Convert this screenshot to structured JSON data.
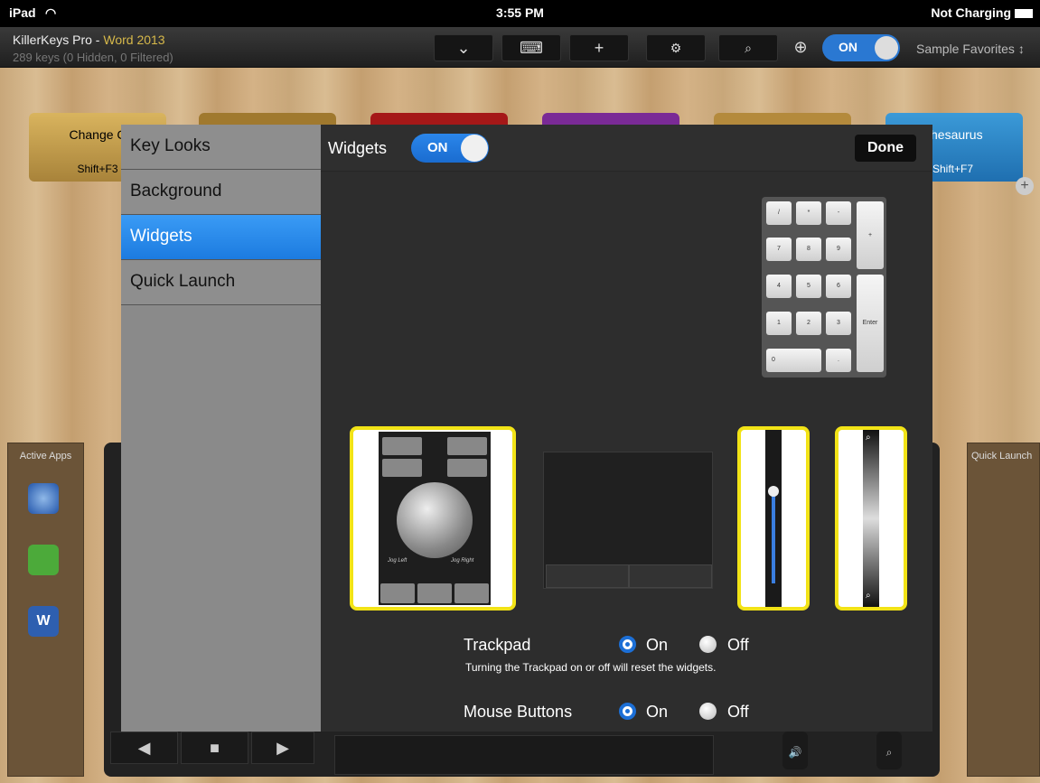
{
  "status_bar": {
    "device": "iPad",
    "time": "3:55 PM",
    "charging": "Not Charging"
  },
  "app_bar": {
    "title_app": "KillerKeys Pro - ",
    "title_doc": "Word 2013",
    "subtitle": "289 keys (0 Hidden, 0 Filtered)",
    "toggle_label": "ON",
    "favorites": "Sample Favorites ↕"
  },
  "background_keys": {
    "key1_label": "Change C",
    "key1_shortcut": "Shift+F3",
    "key6_label": "hesaurus",
    "key6_shortcut": "Shift+F7",
    "colors": [
      "#c9a14e",
      "#b08a3a",
      "#b51414",
      "#7a2a96",
      "#c9a14e",
      "#2a86c8"
    ]
  },
  "lower": {
    "active_apps": "Active Apps",
    "quick_launch": "Quick Launch"
  },
  "sidebar": {
    "items": [
      {
        "label": "Key Looks"
      },
      {
        "label": "Background"
      },
      {
        "label": "Widgets"
      },
      {
        "label": "Quick Launch"
      }
    ],
    "active_index": 2
  },
  "widgets_panel": {
    "title": "Widgets",
    "toggle_label": "ON",
    "done_label": "Done",
    "numpad_keys": [
      "/",
      "*",
      "-",
      "+",
      "7",
      "8",
      "9",
      "4",
      "5",
      "6",
      "1",
      "2",
      "3",
      "Enter",
      "0",
      "."
    ],
    "jog_left": "Jog Left",
    "jog_right": "Jog Right",
    "trackpad_label": "Trackpad",
    "trackpad_value": "On",
    "on_label": "On",
    "off_label": "Off",
    "trackpad_note": "Turning the Trackpad on or off will reset the widgets.",
    "mouse_buttons_label": "Mouse Buttons",
    "mouse_buttons_value": "On"
  }
}
